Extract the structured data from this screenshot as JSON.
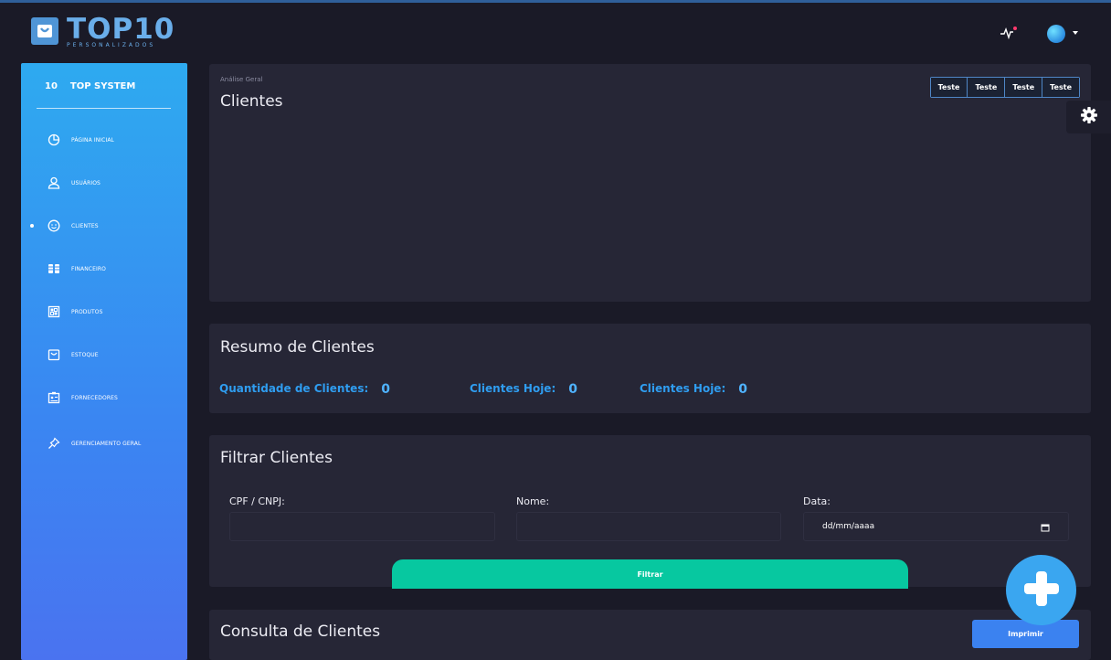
{
  "header": {
    "logo_main": "TOP10",
    "logo_sub": "PERSONALIZADOS"
  },
  "sidebar": {
    "brand_num": "10",
    "brand_name": "TOP SYSTEM",
    "items": [
      {
        "label": "PÁGINA INICIAL",
        "icon": "pie-chart-icon"
      },
      {
        "label": "USUÁRIOS",
        "icon": "user-icon"
      },
      {
        "label": "CLIENTES",
        "icon": "smile-icon",
        "active": true
      },
      {
        "label": "FINANCEIRO",
        "icon": "coins-icon"
      },
      {
        "label": "PRODUTOS",
        "icon": "grid-box-icon"
      },
      {
        "label": "ESTOQUE",
        "icon": "bag-icon"
      },
      {
        "label": "FORNECEDORES",
        "icon": "id-card-icon"
      },
      {
        "label": "GERENCIAMENTO GERAL",
        "icon": "pin-icon"
      }
    ]
  },
  "overview": {
    "breadcrumb": "Análise Geral",
    "title": "Clientes",
    "buttons": [
      "Teste",
      "Teste",
      "Teste",
      "Teste"
    ]
  },
  "summary": {
    "title": "Resumo de Clientes",
    "stats": [
      {
        "label": "Quantidade de Clientes:",
        "value": "0"
      },
      {
        "label": "Clientes Hoje:",
        "value": "0"
      },
      {
        "label": "Clientes Hoje:",
        "value": "0"
      }
    ]
  },
  "filter": {
    "title": "Filtrar Clientes",
    "cpf_label": "CPF / CNPJ:",
    "nome_label": "Nome:",
    "data_label": "Data:",
    "data_placeholder": "dd/mm/aaaa",
    "button": "Filtrar"
  },
  "query": {
    "title": "Consulta de Clientes",
    "print_button": "Imprimir"
  },
  "colors": {
    "accent": "#3b82f0",
    "success": "#07c8a0",
    "stat": "#2f9df0"
  }
}
